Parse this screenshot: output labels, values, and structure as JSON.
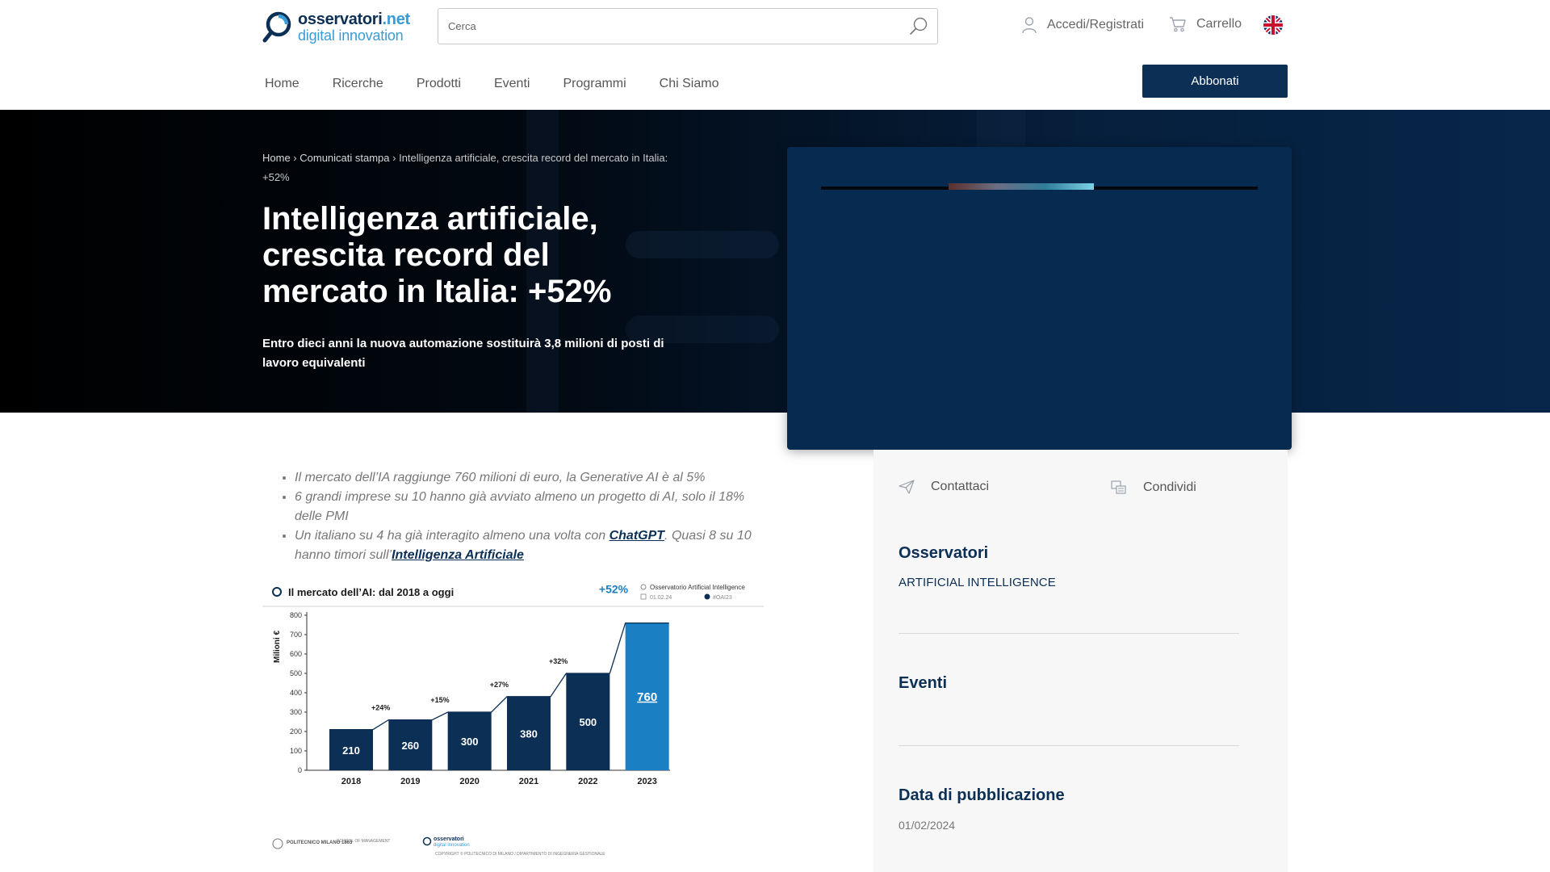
{
  "header": {
    "logo": {
      "line1_main": "osservatori",
      "line1_suffix": ".net",
      "line2": "digital innovation"
    },
    "search": {
      "placeholder": "Cerca"
    },
    "account_label": "Accedi/Registrati",
    "cart_label": "Carrello",
    "nav": [
      "Home",
      "Ricerche",
      "Prodotti",
      "Eventi",
      "Programmi",
      "Chi Siamo"
    ],
    "subscribe_label": "Abbonati"
  },
  "hero": {
    "breadcrumb": [
      "Home",
      "Comunicati stampa",
      "Intelligenza artificiale, crescita record del mercato in Italia: +52%"
    ],
    "title": "Intelligenza artificiale, crescita record del mercato in Italia: +52%",
    "subtitle": "Entro dieci anni la nuova automazione sostituirà   3,8 milioni di posti di lavoro equivalenti"
  },
  "content": {
    "bullet1": "Il mercato dell’IA raggiunge 760 milioni di euro, la Generative AI è al 5%",
    "bullet2": "6 grandi imprese su 10 hanno già   avviato almeno un progetto di AI, solo il 18% delle PMI",
    "bullet3_before": "Un italiano su 4 ha già   interagito almeno una volta con ",
    "bullet3_link1": "ChatGPT",
    "bullet3_middle": ". Quasi 8 su 10 hanno timori sull’",
    "bullet3_link2": "Intelligenza Artificiale"
  },
  "infographic": {
    "title": "Il mercato dell’AI: dal 2018 a oggi",
    "source_label": "Osservatorio Artificial Intelligence",
    "date_label": "01.02.24",
    "hashtag": "#OAI23",
    "ylabel": "Milioni €",
    "yticks": [
      "800",
      "700",
      "600",
      "500",
      "400",
      "300",
      "200",
      "100",
      "0"
    ],
    "footer_left": "POLITECNICO MILANO 1863",
    "footer_mid": "SCHOOL OF MANAGEMENT",
    "footer_copyright": "COPYRIGHT © POLITECNICO DI MILANO / DIPARTIMENTO DI INGEGNERIA GESTIONALE",
    "growth_labels": [
      "+24%",
      "+15%",
      "+27%",
      "+32%",
      "+52%"
    ]
  },
  "chart_data": {
    "type": "bar",
    "title": "Il mercato dell’AI: dal 2018 a oggi",
    "ylabel": "Milioni €",
    "categories": [
      "2018",
      "2019",
      "2020",
      "2021",
      "2022",
      "2023"
    ],
    "values": [
      210,
      260,
      300,
      380,
      500,
      760
    ],
    "ylim": [
      0,
      800
    ],
    "colors": {
      "bars": "#0c2f55",
      "highlight": "#1b7fc4",
      "line": "#0c2f55"
    }
  },
  "sidebar": {
    "contact_label": "Contattaci",
    "share_label": "Condividi",
    "observatories_heading": "Osservatori",
    "observatory_link": "ARTIFICIAL INTELLIGENCE",
    "events_heading": "Eventi",
    "date_heading": "Data di pubblicazione",
    "date_value": "01/02/2024"
  },
  "colors": {
    "brand": "#0c2f55",
    "accent": "#3a9bd5"
  }
}
